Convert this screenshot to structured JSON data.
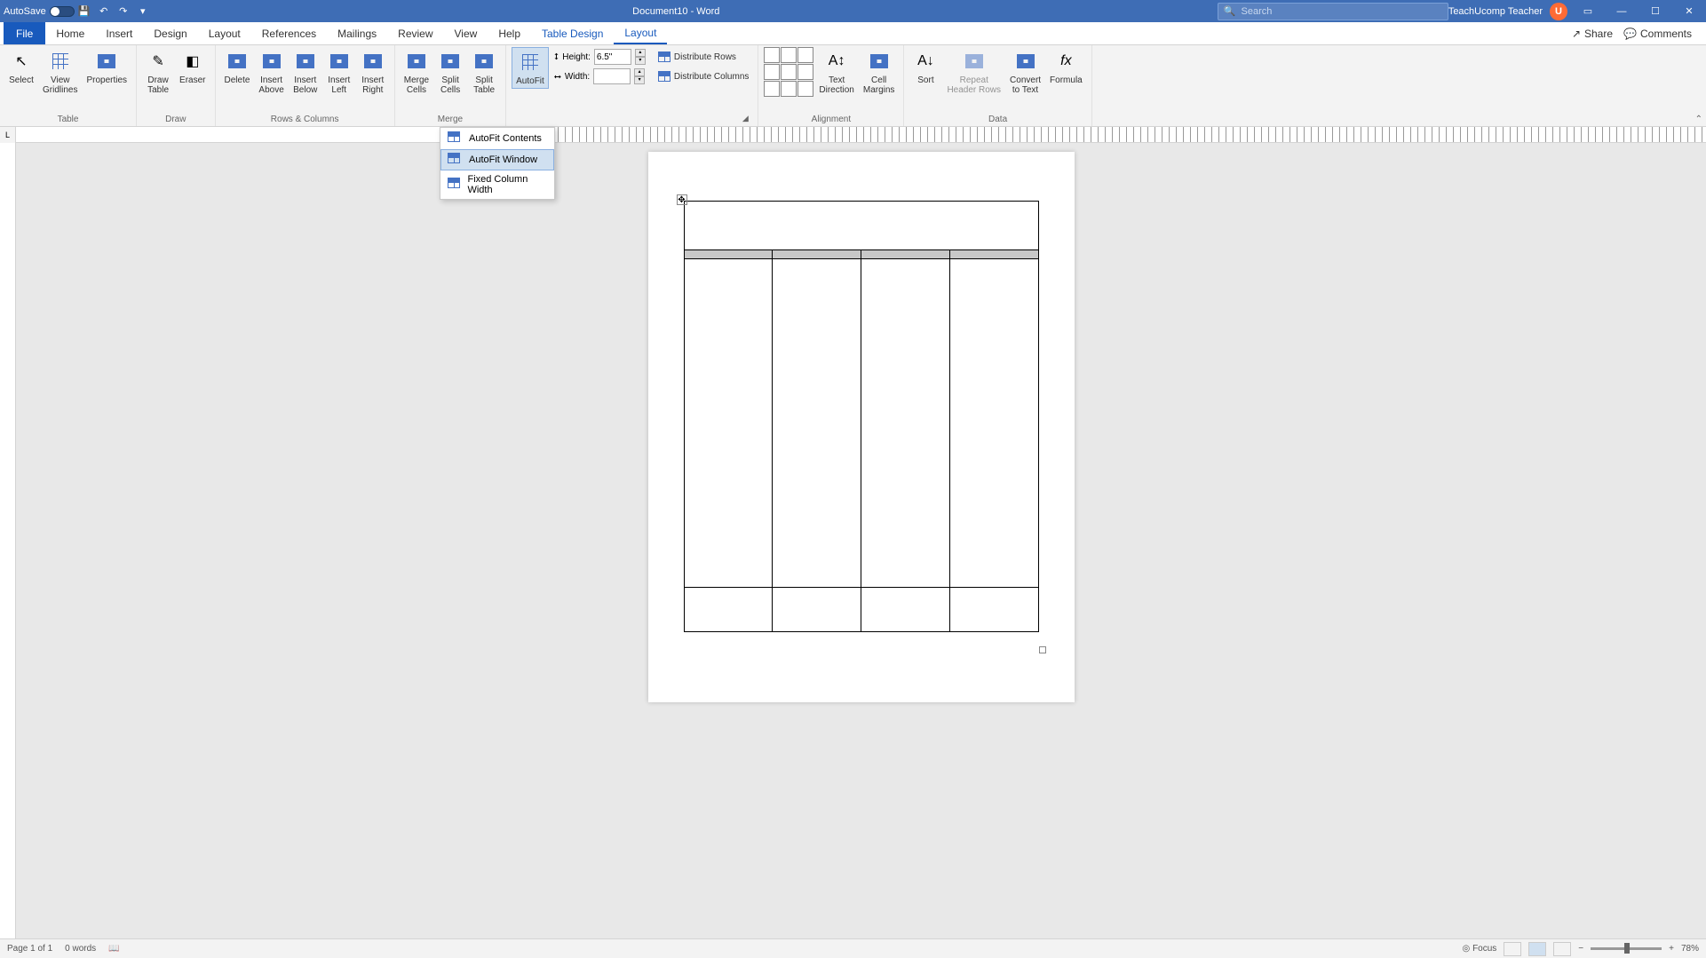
{
  "titleBar": {
    "autoSave": "AutoSave",
    "autoSaveState": "Off",
    "docTitle": "Document10 - Word",
    "searchPlaceholder": "Search",
    "userName": "TeachUcomp Teacher",
    "userInitial": "U"
  },
  "tabs": {
    "file": "File",
    "home": "Home",
    "insert": "Insert",
    "design": "Design",
    "layout": "Layout",
    "references": "References",
    "mailings": "Mailings",
    "review": "Review",
    "view": "View",
    "help": "Help",
    "tableDesign": "Table Design",
    "tableLayout": "Layout",
    "share": "Share",
    "comments": "Comments"
  },
  "ribbon": {
    "table": {
      "label": "Table",
      "select": "Select",
      "gridlines": "View\nGridlines",
      "properties": "Properties"
    },
    "draw": {
      "label": "Draw",
      "drawTable": "Draw\nTable",
      "eraser": "Eraser"
    },
    "rowsCols": {
      "label": "Rows & Columns",
      "delete": "Delete",
      "insertAbove": "Insert\nAbove",
      "insertBelow": "Insert\nBelow",
      "insertLeft": "Insert\nLeft",
      "insertRight": "Insert\nRight"
    },
    "merge": {
      "label": "Merge",
      "mergeCells": "Merge\nCells",
      "splitCells": "Split\nCells",
      "splitTable": "Split\nTable"
    },
    "cellSize": {
      "autofit": "AutoFit",
      "height": "Height:",
      "heightVal": "6.5\"",
      "width": "Width:",
      "widthVal": "",
      "distRows": "Distribute Rows",
      "distCols": "Distribute Columns"
    },
    "alignment": {
      "label": "Alignment",
      "textDir": "Text\nDirection",
      "cellMargins": "Cell\nMargins"
    },
    "data": {
      "label": "Data",
      "sort": "Sort",
      "repeatHdr": "Repeat\nHeader Rows",
      "convertText": "Convert\nto Text",
      "formula": "Formula"
    }
  },
  "dropdown": {
    "autofitContents": "AutoFit Contents",
    "autofitWindow": "AutoFit Window",
    "fixedWidth": "Fixed Column Width"
  },
  "statusBar": {
    "page": "Page 1 of 1",
    "words": "0 words",
    "focus": "Focus",
    "zoom": "78%"
  }
}
